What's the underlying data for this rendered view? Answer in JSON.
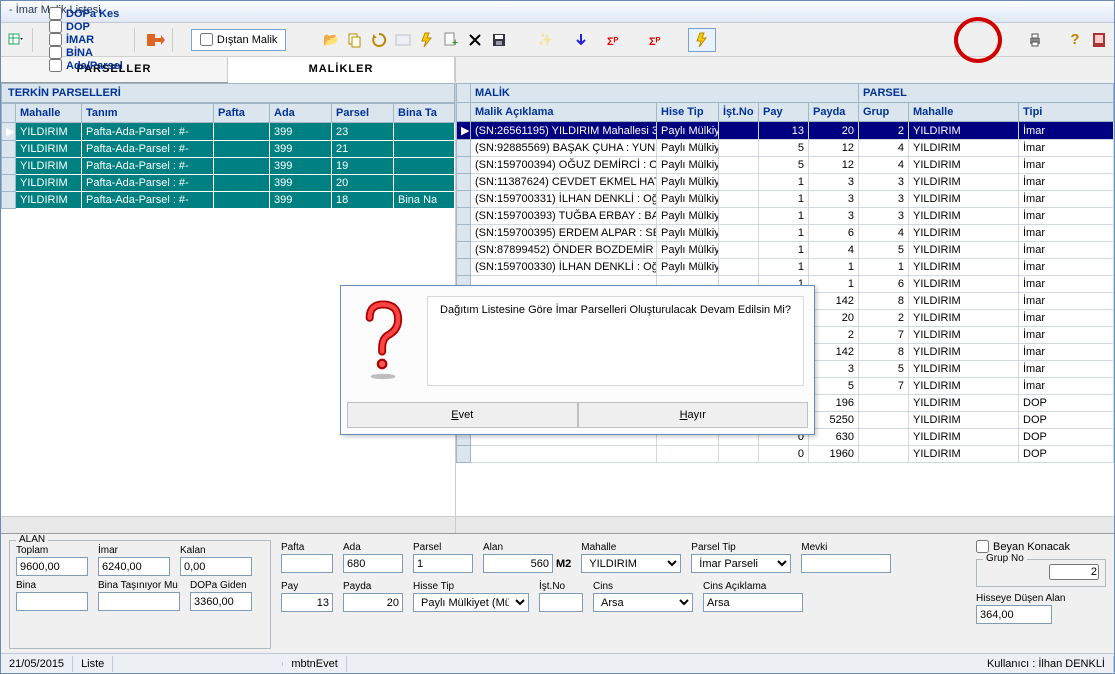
{
  "title": "- İmar Malik Listesi",
  "toolbar": {
    "checks": [
      {
        "label": "DOPa Kes"
      },
      {
        "label": "DOP"
      },
      {
        "label": "İMAR"
      },
      {
        "label": "BİNA"
      },
      {
        "label": "Ada/Parsel"
      }
    ],
    "outside": "Dıştan Malik"
  },
  "tabs": {
    "parseller": "PARSELLER",
    "malikler": "MALİKLER"
  },
  "left": {
    "title": "TERKİN PARSELLERİ",
    "headers": [
      "Mahalle",
      "Tanım",
      "Pafta",
      "Ada",
      "Parsel",
      "Bina Ta"
    ],
    "rows": [
      [
        "YILDIRIM",
        "Pafta-Ada-Parsel : #-",
        "",
        "399",
        "23",
        ""
      ],
      [
        "YILDIRIM",
        "Pafta-Ada-Parsel : #-",
        "",
        "399",
        "21",
        ""
      ],
      [
        "YILDIRIM",
        "Pafta-Ada-Parsel : #-",
        "",
        "399",
        "19",
        ""
      ],
      [
        "YILDIRIM",
        "Pafta-Ada-Parsel : #-",
        "",
        "399",
        "20",
        ""
      ],
      [
        "YILDIRIM",
        "Pafta-Ada-Parsel : #-",
        "",
        "399",
        "18",
        "Bina Na"
      ]
    ]
  },
  "right": {
    "group1": "MALİK",
    "group2": "PARSEL",
    "headers": [
      "Malik Açıklama",
      "Hise Tip",
      "İşt.No",
      "Pay",
      "Payda",
      "Grup",
      "Mahalle",
      "Tipi"
    ],
    "rows": [
      [
        "(SN:26561195) YILDIRIM Mahallesi 3",
        "Paylı Mülkiye",
        "",
        "13",
        "20",
        "2",
        "YILDIRIM",
        "İmar"
      ],
      [
        "(SN:92885569) BAŞAK ÇUHA : YUNU",
        "Paylı Mülkiye",
        "",
        "5",
        "12",
        "4",
        "YILDIRIM",
        "İmar"
      ],
      [
        "(SN:159700394) OĞUZ DEMİRCİ : O",
        "Paylı Mülkiye",
        "",
        "5",
        "12",
        "4",
        "YILDIRIM",
        "İmar"
      ],
      [
        "(SN:11387624) CEVDET EKMEL HAT",
        "Paylı Mülkiye",
        "",
        "1",
        "3",
        "3",
        "YILDIRIM",
        "İmar"
      ],
      [
        "(SN:159700331) İLHAN DENKLİ : Oğ",
        "Paylı Mülkiye",
        "",
        "1",
        "3",
        "3",
        "YILDIRIM",
        "İmar"
      ],
      [
        "(SN:159700393) TUĞBA ERBAY : BA",
        "Paylı Mülkiye",
        "",
        "1",
        "3",
        "3",
        "YILDIRIM",
        "İmar"
      ],
      [
        "(SN:159700395) ERDEM ALPAR : SE",
        "Paylı Mülkiye",
        "",
        "1",
        "6",
        "4",
        "YILDIRIM",
        "İmar"
      ],
      [
        "(SN:87899452) ÖNDER BOZDEMİR :",
        "Paylı Mülkiye",
        "",
        "1",
        "4",
        "5",
        "YILDIRIM",
        "İmar"
      ],
      [
        "(SN:159700330) İLHAN DENKLİ : Oğ",
        "Paylı Mülkiye",
        "",
        "1",
        "1",
        "1",
        "YILDIRIM",
        "İmar"
      ],
      [
        "",
        "",
        "",
        "1",
        "1",
        "6",
        "YILDIRIM",
        "İmar"
      ],
      [
        "",
        "",
        "",
        "142",
        "8",
        "YILDIRIM",
        "İmar"
      ],
      [
        "",
        "",
        "",
        "20",
        "2",
        "YILDIRIM",
        "İmar"
      ],
      [
        "",
        "",
        "",
        "2",
        "7",
        "YILDIRIM",
        "İmar"
      ],
      [
        "",
        "",
        "",
        "142",
        "8",
        "YILDIRIM",
        "İmar"
      ],
      [
        "",
        "",
        "",
        "3",
        "5",
        "YILDIRIM",
        "İmar"
      ],
      [
        "",
        "",
        "",
        "5",
        "7",
        "YILDIRIM",
        "İmar"
      ],
      [
        "",
        "",
        "",
        "0",
        "196",
        "",
        "YILDIRIM",
        "DOP"
      ],
      [
        "",
        "",
        "",
        "0",
        "5250",
        "",
        "YILDIRIM",
        "DOP"
      ],
      [
        "",
        "",
        "",
        "0",
        "630",
        "",
        "YILDIRIM",
        "DOP"
      ],
      [
        "",
        "",
        "",
        "0",
        "1960",
        "",
        "YILDIRIM",
        "DOP"
      ]
    ]
  },
  "alan": {
    "legend": "ALAN",
    "toplam_l": "Toplam",
    "toplam": "9600,00",
    "imar_l": "İmar",
    "imar": "6240,00",
    "kalan_l": "Kalan",
    "kalan": "0,00",
    "bina_l": "Bina",
    "bina": "",
    "bt_l": "Bina Taşınıyor Mu",
    "bt": "",
    "dop_l": "DOPa Giden",
    "dop": "3360,00"
  },
  "parcel": {
    "pafta_l": "Pafta",
    "pafta": "",
    "ada_l": "Ada",
    "ada": "680",
    "parsel_l": "Parsel",
    "parsel": "1",
    "alan_l": "Alan",
    "alan": "560",
    "alan_unit": "M2",
    "mahalle_l": "Mahalle",
    "mahalle": "YILDIRIM",
    "ptip_l": "Parsel Tip",
    "ptip": "İmar Parseli",
    "mevki_l": "Mevki",
    "mevki": "",
    "pay_l": "Pay",
    "pay": "13",
    "payda_l": "Payda",
    "payda": "20",
    "htip_l": "Hisse Tip",
    "htip": "Paylı Mülkiyet (Mü",
    "istno_l": "İşt.No",
    "istno": "",
    "cins_l": "Cins",
    "cins": "Arsa",
    "cinsa_l": "Cins Açıklama",
    "cinsa": "Arsa"
  },
  "right_panel": {
    "beyan": "Beyan Konacak",
    "grupno_l": "Grup No",
    "grupno": "2",
    "hisse_l": "Hisseye Düşen Alan",
    "hisse": "364,00"
  },
  "dialog": {
    "text": "Dağıtım Listesine Göre İmar Parselleri Oluşturulacak Devam Edilsin Mi?",
    "yes": "Evet",
    "no": "Hayır"
  },
  "status": {
    "date": "21/05/2015",
    "mode": "Liste",
    "btn": "mbtnEvet",
    "user_l": "Kullanıcı :",
    "user": "İlhan  DENKLİ"
  }
}
